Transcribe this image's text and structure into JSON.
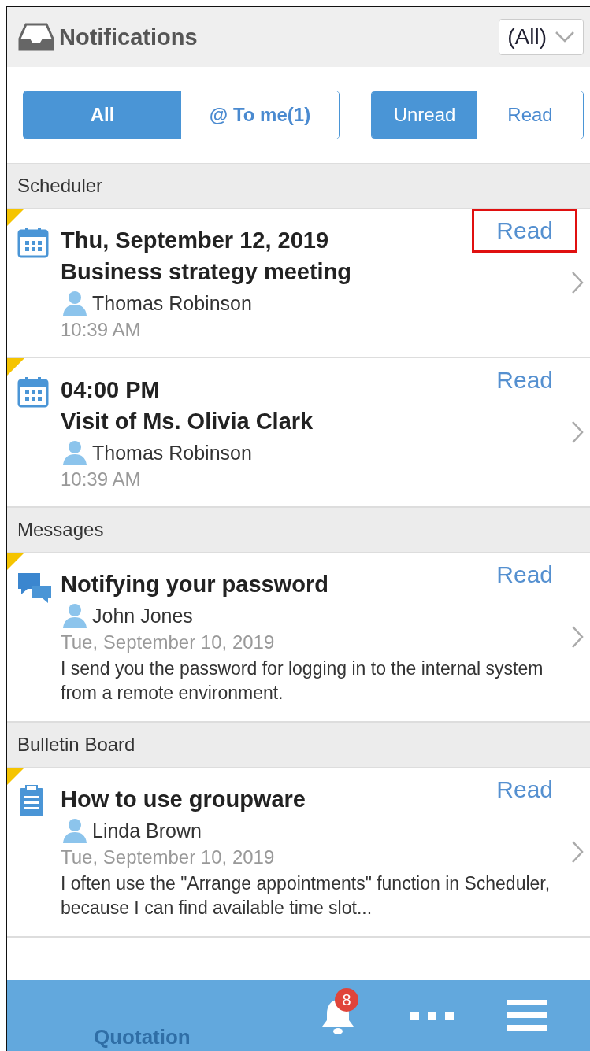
{
  "header": {
    "title": "Notifications",
    "filter": "(All)"
  },
  "scope_tabs": [
    {
      "label": "All",
      "selected": true
    },
    {
      "label": "@ To me(1)",
      "selected": false
    }
  ],
  "status_tabs": [
    {
      "label": "Unread",
      "selected": true
    },
    {
      "label": "Read",
      "selected": false
    }
  ],
  "sections": [
    {
      "title": "Scheduler",
      "items": [
        {
          "kind": "event",
          "unread": true,
          "highlighted": true,
          "titles": [
            "Thu, September 12, 2019",
            "Business strategy meeting"
          ],
          "user": "Thomas Robinson",
          "time": "10:39 AM",
          "action": "Read"
        },
        {
          "kind": "event",
          "unread": true,
          "highlighted": false,
          "titles": [
            "04:00 PM",
            "Visit of Ms. Olivia Clark"
          ],
          "user": "Thomas Robinson",
          "time": "10:39 AM",
          "action": "Read"
        }
      ]
    },
    {
      "title": "Messages",
      "items": [
        {
          "kind": "message",
          "unread": true,
          "highlighted": false,
          "titles": [
            "Notifying your password"
          ],
          "user": "John Jones",
          "time": "Tue, September 10, 2019",
          "body": "I send you the password for logging in to the internal system from a remote environment.",
          "action": "Read"
        }
      ]
    },
    {
      "title": "Bulletin Board",
      "items": [
        {
          "kind": "bulletin",
          "unread": true,
          "highlighted": false,
          "titles": [
            "How to use groupware"
          ],
          "user": "Linda Brown",
          "time": "Tue, September 10, 2019",
          "body": "I often use the \"Arrange appointments\" function in Scheduler, because I can find available time slot...",
          "action": "Read"
        }
      ]
    }
  ],
  "peek_item": {
    "title": "Quotation"
  },
  "bottom_bar": {
    "badge": "8"
  }
}
